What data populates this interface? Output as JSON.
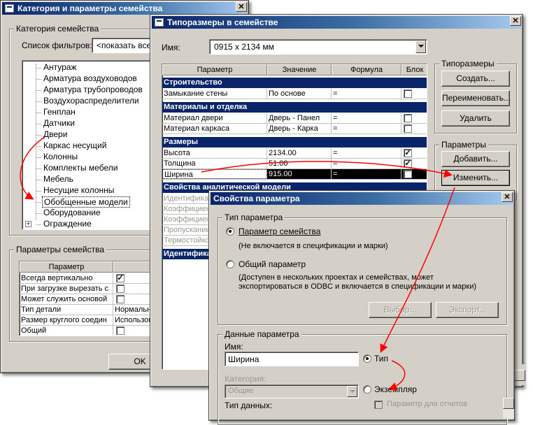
{
  "family_category_dialog": {
    "title": "Категория и параметры семейства",
    "category_group": "Категория семейства",
    "filter_label": "Список фильтров:",
    "filter_value": "<показать все>",
    "categories": [
      "Антураж",
      "Арматура воздуховодов",
      "Арматура трубопроводов",
      "Воздухораспределители",
      "Генплан",
      "Датчики",
      "Двери",
      "Каркас несущий",
      "Колонны",
      "Комплекты мебели",
      "Мебель",
      "Несущие колонны",
      "Обобщенные модели",
      "Оборудование",
      "Ограждение"
    ],
    "selected_category": "Обобщенные модели",
    "expand_glyph": "+",
    "params_group": "Параметры семейства",
    "params_header": "Параметр",
    "params_rows": [
      {
        "name": "Всегда вертикально",
        "value": "✓"
      },
      {
        "name": "При загрузке вырезать с",
        "value": ""
      },
      {
        "name": "Может служить основой",
        "value": ""
      },
      {
        "name": "Тип детали",
        "value": "Нормальный"
      },
      {
        "name": "Размер круглого соедин",
        "value": "Использовать"
      },
      {
        "name": "Общий",
        "value": ""
      }
    ],
    "ok_label": "OK"
  },
  "types_dialog": {
    "title": "Типоразмеры в семействе",
    "name_label": "Имя:",
    "name_value": "0915 x 2134 мм",
    "columns": [
      "Параметр",
      "Значение",
      "Формула",
      "Блок"
    ],
    "groups": [
      {
        "title": "Строительство",
        "rows": [
          {
            "p": "Замыкание стены",
            "v": "По основе",
            "f": "=",
            "lock": false
          }
        ]
      },
      {
        "title": "Материалы и отделка",
        "rows": [
          {
            "p": "Материал двери",
            "v": "Дверь - Панел",
            "f": "=",
            "lock": false
          },
          {
            "p": "Материал каркаса",
            "v": "Дверь - Карка",
            "f": "=",
            "lock": false
          }
        ]
      },
      {
        "title": "Размеры",
        "rows": [
          {
            "p": "Высота",
            "v": "2134.00",
            "f": "=",
            "lock": true
          },
          {
            "p": "Толщина",
            "v": "51.00",
            "f": "=",
            "lock": true
          },
          {
            "p": "Ширина",
            "v": "915.00",
            "f": "=",
            "lock": true
          }
        ]
      },
      {
        "title": "Свойства аналитической модели",
        "rows": [
          {
            "p": "Идентифика",
            "v": "",
            "f": "",
            "lock": false
          },
          {
            "p": "Коэффициен",
            "v": "",
            "f": "",
            "lock": false
          },
          {
            "p": "Коэффициен",
            "v": "",
            "f": "",
            "lock": false
          },
          {
            "p": "Пропускание",
            "v": "",
            "f": "",
            "lock": false
          },
          {
            "p": "Термостойко",
            "v": "",
            "f": "",
            "lock": false
          }
        ]
      },
      {
        "title": "Идентифика",
        "rows": []
      }
    ],
    "selected_param": "Ширина",
    "types_group": "Типоразмеры",
    "create_label": "Создать...",
    "rename_label": "Переименовать...",
    "delete_label": "Удалить",
    "params_group": "Параметры",
    "add_label": "Добавить...",
    "modify_label": "Изменить..."
  },
  "param_props_dialog": {
    "title": "Свойства параметра",
    "type_group": "Тип параметра",
    "family_param_label": "Параметр семейства",
    "family_param_note": "(Не включается в спецификации и марки)",
    "shared_param_label": "Общий параметр",
    "shared_param_note_1": "(Доступен в нескольких проектах и семействах, может",
    "shared_param_note_2": "экспортироваться в ODBC и включается в спецификации и марки)",
    "select_label": "Выбор...",
    "export_label": "Экспорт...",
    "data_group": "Данные параметра",
    "name_label": "Имя:",
    "name_value": "Ширина",
    "type_radio": "Тип",
    "category_label": "Категория:",
    "category_value": "Общие",
    "instance_radio": "Экземпляр",
    "datatype_label": "Тип данных:",
    "report_param_label": "Параметр для отчетов"
  },
  "colors": {
    "title_active": "#0a246a",
    "arrow": "#ff0000",
    "dialog_face": "#d4d0c8"
  }
}
